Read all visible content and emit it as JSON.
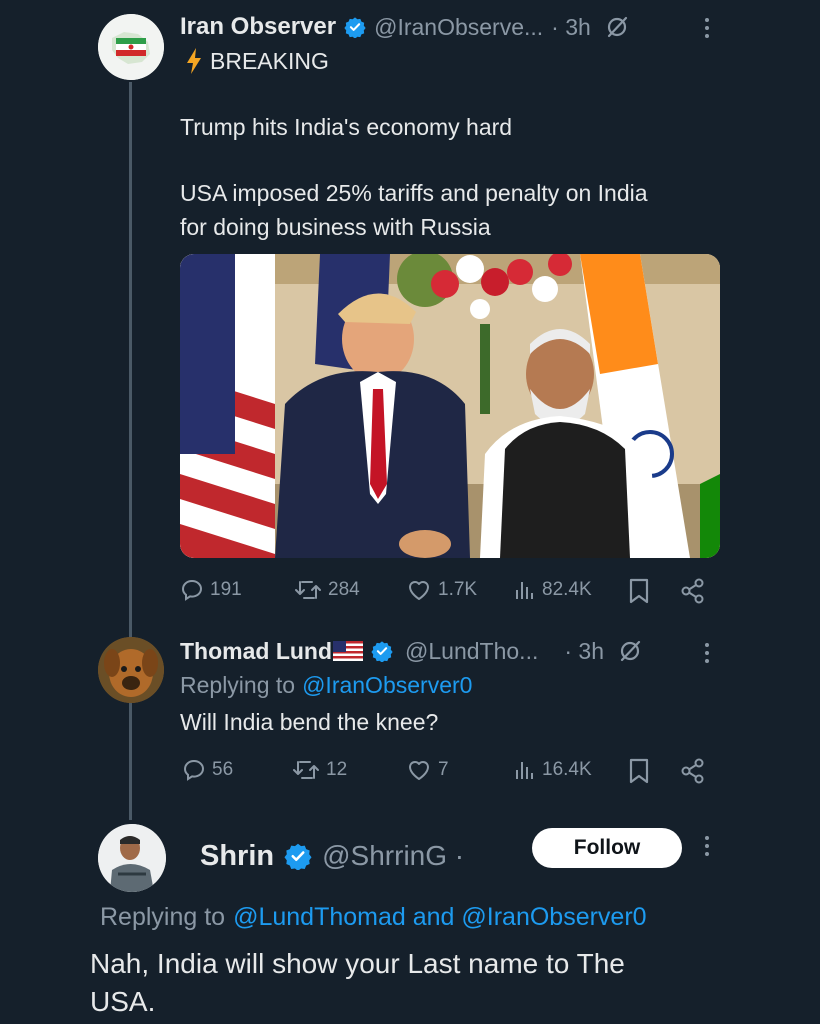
{
  "tweet1": {
    "author_name": "Iran Observer",
    "handle": "@IranObserve...",
    "time": "· 3h",
    "breaking": "BREAKING",
    "line1": "Trump hits India's economy hard",
    "line2": "USA imposed 25% tariffs and penalty on India",
    "line3": "for doing business with Russia",
    "stats": {
      "replies": "191",
      "reposts": "284",
      "likes": "1.7K",
      "views": "82.4K"
    }
  },
  "tweet2": {
    "author_name": "Thomad Lund",
    "handle": "@LundTho...",
    "time": "· 3h",
    "replying_prefix": "Replying to",
    "replying_handle": "@IranObserver0",
    "text": "Will India bend the knee?",
    "stats": {
      "replies": "56",
      "reposts": "12",
      "likes": "7",
      "views": "16.4K"
    }
  },
  "tweet3": {
    "author_name": "Shrin",
    "handle": "@ShrrinG ·",
    "follow_label": "Follow",
    "replying_prefix": "Replying to",
    "replying_handles": "@LundThomad and @IranObserver0",
    "line1": "Nah, India will show your Last name to The",
    "line2": "USA."
  },
  "colors": {
    "background": "#15202b",
    "accent": "#1d9bf0",
    "muted": "#8b98a5",
    "text": "#e7e9ea"
  }
}
